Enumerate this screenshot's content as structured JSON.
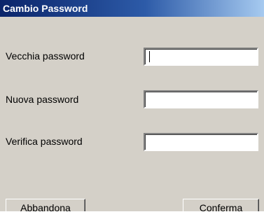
{
  "window": {
    "title": "Cambio Password"
  },
  "form": {
    "old_password": {
      "label": "Vecchia password",
      "value": ""
    },
    "new_password": {
      "label": "Nuova password",
      "value": ""
    },
    "verify_password": {
      "label": "Verifica password",
      "value": ""
    }
  },
  "buttons": {
    "cancel_label": "Abbandona",
    "confirm_label": "Conferma"
  }
}
